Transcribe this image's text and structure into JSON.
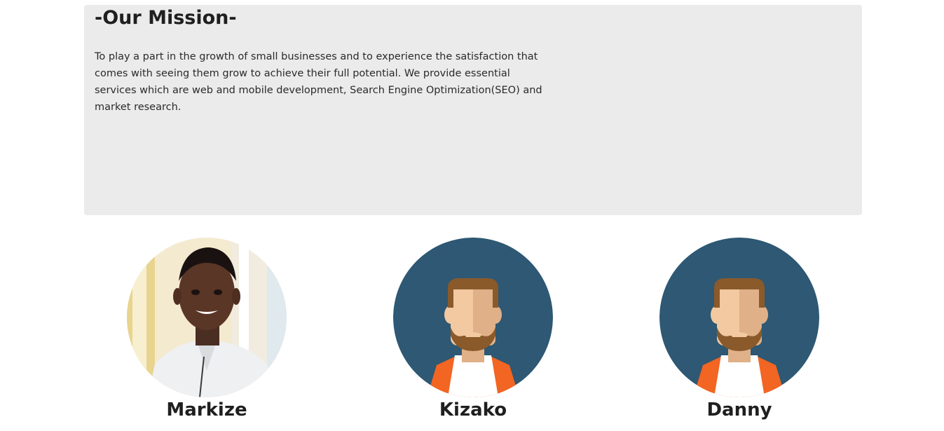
{
  "mission": {
    "title": "-Our Mission-",
    "text": "To play a part in the growth of small businesses and to experience the satisfaction that comes with seeing them grow to achieve their full potential. We provide essential services which are web and mobile development, Search Engine Optimization(SEO) and market research."
  },
  "team": [
    {
      "name": "Markize",
      "avatar": "photo-portrait"
    },
    {
      "name": "Kizako",
      "avatar": "avatar-bearded-man-icon"
    },
    {
      "name": "Danny",
      "avatar": "avatar-bearded-man-icon"
    }
  ],
  "colors": {
    "mission_bg": "#ebebeb",
    "avatar_bg": "#2e5873",
    "jacket": "#f26522",
    "hair": "#8a5a2b",
    "skin_light": "#f2c9a1",
    "skin_dark": "#e0b088"
  }
}
